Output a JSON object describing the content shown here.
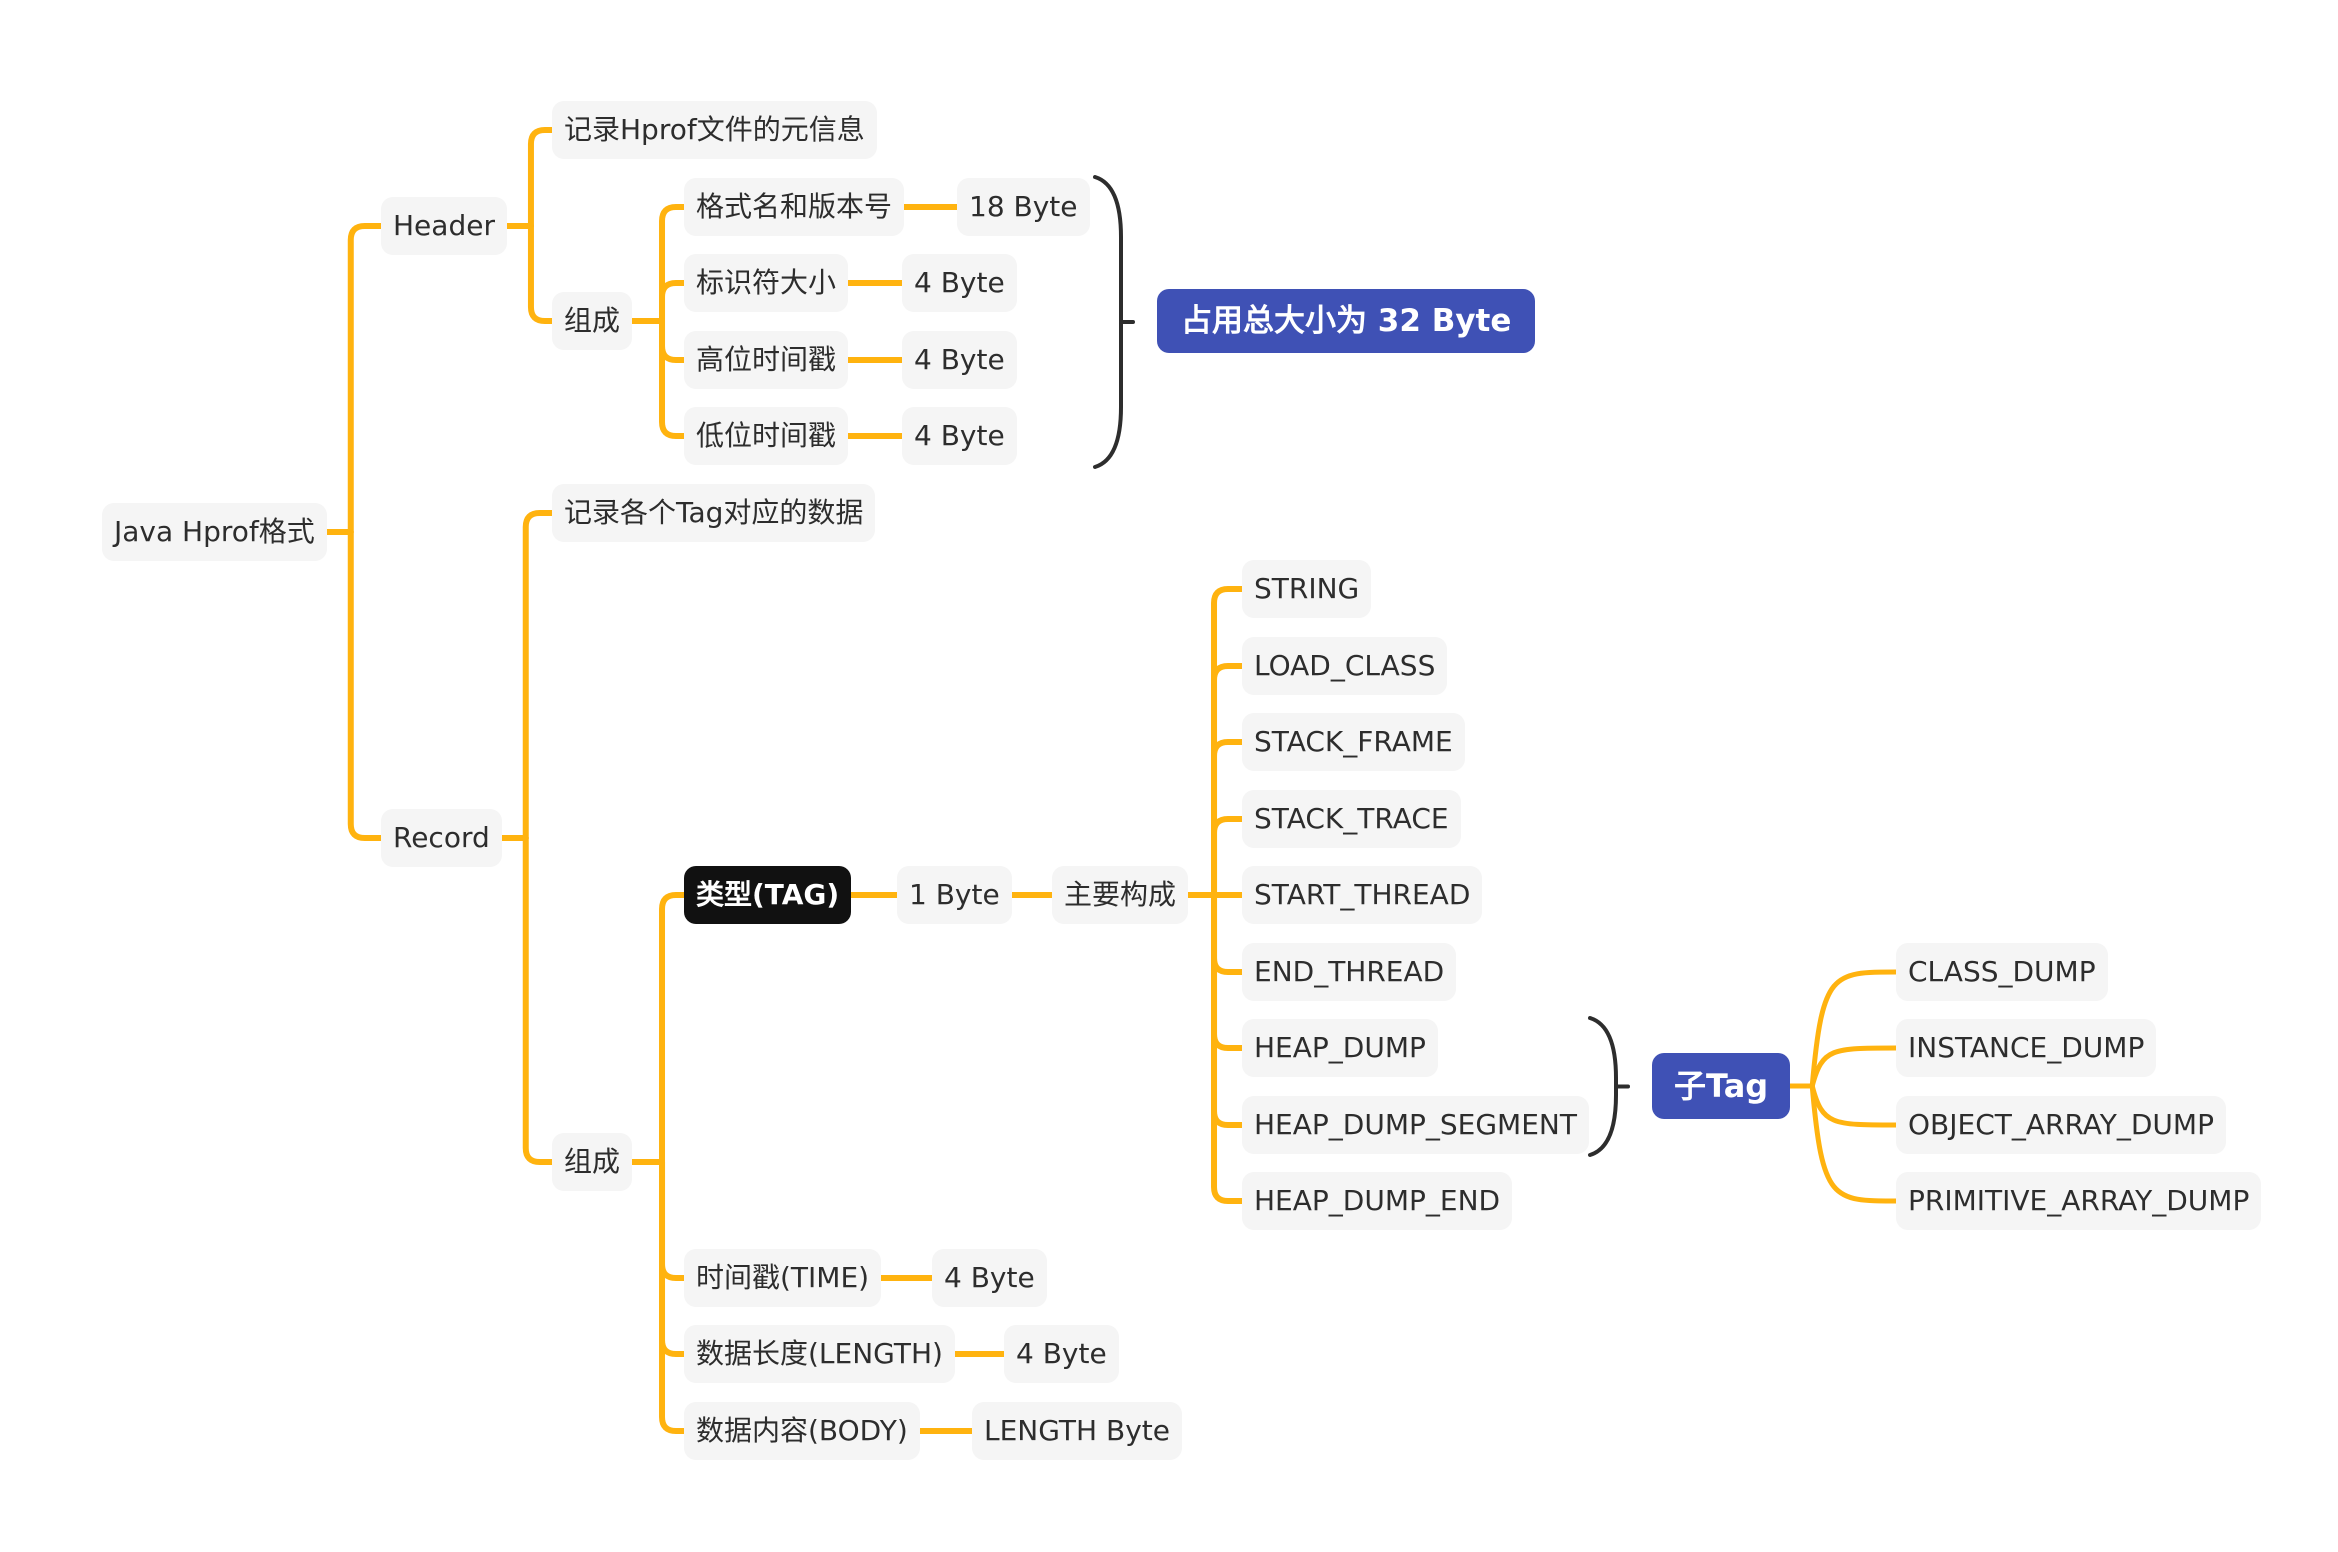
{
  "colors": {
    "branch": "#ffb30f",
    "node_bg": "#f5f5f5",
    "node_text": "#2d2d2d",
    "summary_bg": "#3f51b5",
    "tag_bg": "#111111",
    "brace": "#2d2d2d"
  },
  "root": {
    "label": "Java Hprof格式"
  },
  "header": {
    "label": "Header",
    "desc": "记录Hprof文件的元信息",
    "compose_label": "组成",
    "fields": [
      {
        "label": "格式名和版本号",
        "size": "18 Byte"
      },
      {
        "label": "标识符大小",
        "size": "4 Byte"
      },
      {
        "label": "高位时间戳",
        "size": "4 Byte"
      },
      {
        "label": "低位时间戳",
        "size": "4 Byte"
      }
    ],
    "summary": "占用总大小为 32 Byte"
  },
  "record": {
    "label": "Record",
    "desc": "记录各个Tag对应的数据",
    "compose_label": "组成",
    "tag": {
      "label": "类型(TAG)",
      "size": "1 Byte",
      "main_label": "主要构成"
    },
    "tags": [
      "STRING",
      "LOAD_CLASS",
      "STACK_FRAME",
      "STACK_TRACE",
      "START_THREAD",
      "END_THREAD",
      "HEAP_DUMP",
      "HEAP_DUMP_SEGMENT",
      "HEAP_DUMP_END"
    ],
    "subtag_label": "子Tag",
    "subtags": [
      "CLASS_DUMP",
      "INSTANCE_DUMP",
      "OBJECT_ARRAY_DUMP",
      "PRIMITIVE_ARRAY_DUMP"
    ],
    "fields": [
      {
        "label": "时间戳(TIME)",
        "size": "4 Byte"
      },
      {
        "label": "数据长度(LENGTH)",
        "size": "4 Byte"
      },
      {
        "label": "数据内容(BODY)",
        "size": "LENGTH Byte"
      }
    ]
  }
}
